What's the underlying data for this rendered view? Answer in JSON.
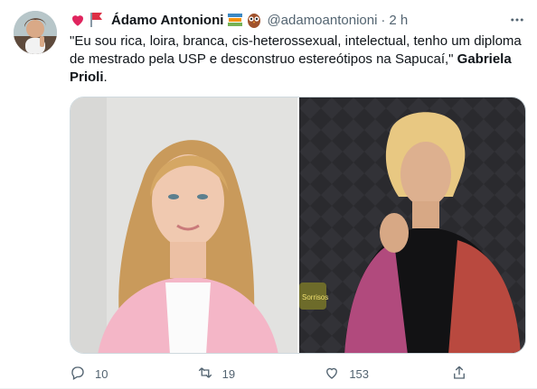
{
  "tweet": {
    "author_name": "Ádamo Antonioni",
    "handle": "@adamoantonioni",
    "separator": "·",
    "time": "2 h",
    "text_main": "\"Eu sou rica, loira, branca, cis-heterossexual, intelectual, tenho um diploma de mestrado pela USP e desconstruo estereótipos na Sapucaí,\" ",
    "text_bold": "Gabriela Prioli",
    "text_end": ".",
    "media_badge": "Sorrisos",
    "actions": {
      "replies": "10",
      "retweets": "19",
      "likes": "153"
    },
    "icons": [
      "heart-emoji",
      "red-flag-emoji",
      "books-emoji",
      "owl-emoji",
      "more-icon",
      "reply-icon",
      "retweet-icon",
      "like-icon",
      "share-icon"
    ]
  },
  "colors": {
    "text_primary": "#0f1419",
    "text_secondary": "#536471",
    "heart": "#e0245e",
    "flag": "#dd2e44",
    "border": "#cfd9de"
  }
}
